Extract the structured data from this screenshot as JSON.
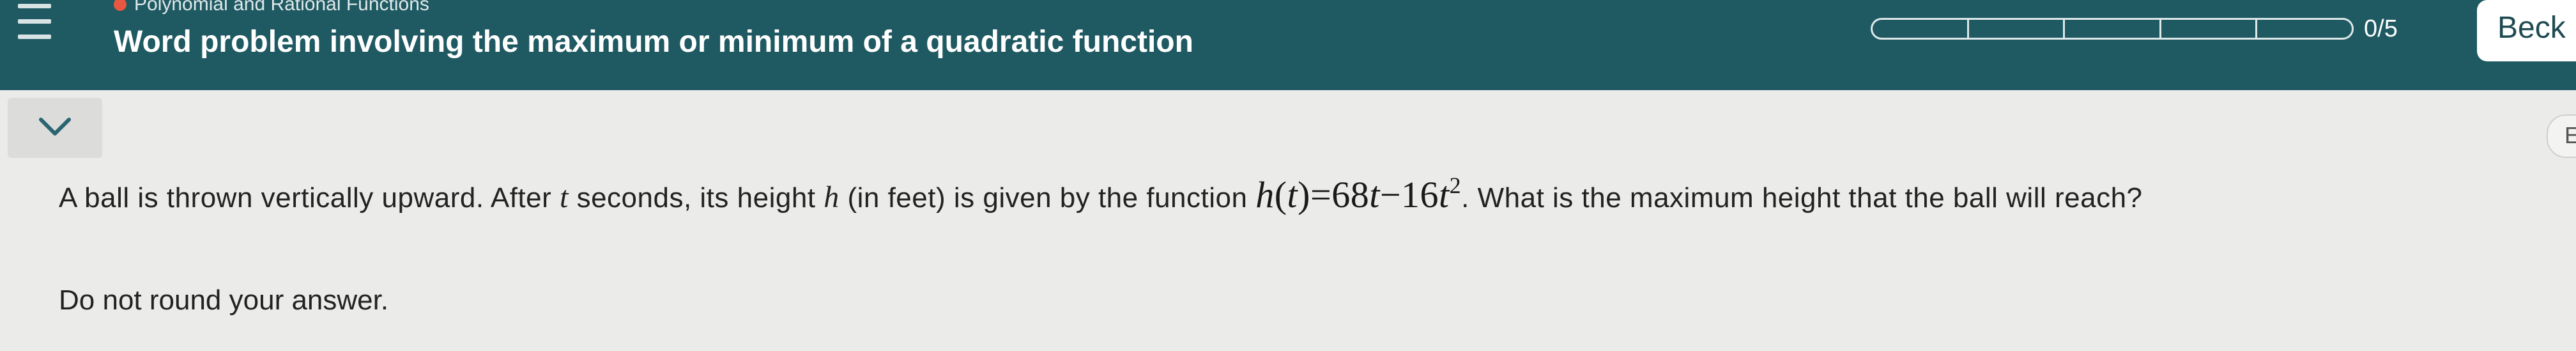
{
  "header": {
    "topic": "Polynomial and Rational Functions",
    "title": "Word problem involving the maximum or minimum of a quadratic function",
    "progress": {
      "completed": 0,
      "total": 5,
      "label": "0/5"
    },
    "back_label": "Beck",
    "colors": {
      "header_bg": "#1f5a63",
      "topic_dot": "#e8573f"
    },
    "icons": {
      "menu": "hamburger-menu-icon"
    }
  },
  "panel": {
    "collapse_icon": "chevron-down-icon",
    "side_tab_letter": "E"
  },
  "question": {
    "part1": "A ball is thrown vertically upward. After ",
    "var_t": "t",
    "part2": " seconds, its height ",
    "var_h": "h",
    "part3": " (in feet) is given by the function ",
    "formula": {
      "fn": "h",
      "lparen": "(",
      "arg": "t",
      "rparen": ")",
      "eq": "=",
      "coef1": "68",
      "var1": "t",
      "minus": "−",
      "coef2": "16",
      "var2": "t",
      "exp": "2"
    },
    "part4": ". What is the maximum height that the ball will reach?"
  },
  "instruction": "Do not round your answer."
}
